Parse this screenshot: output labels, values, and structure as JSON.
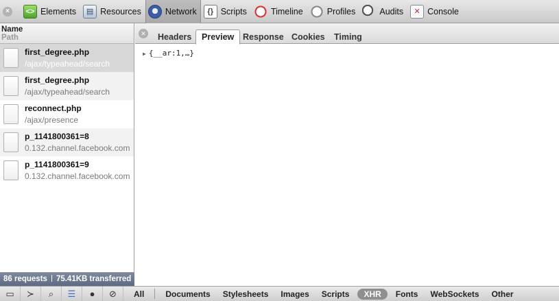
{
  "toolbar": {
    "items": [
      {
        "label": "Elements",
        "icon": "elements-icon",
        "active": false
      },
      {
        "label": "Resources",
        "icon": "resources-icon",
        "active": false
      },
      {
        "label": "Network",
        "icon": "network-icon",
        "active": true
      },
      {
        "label": "Scripts",
        "icon": "scripts-icon",
        "active": false
      },
      {
        "label": "Timeline",
        "icon": "timeline-icon",
        "active": false
      },
      {
        "label": "Profiles",
        "icon": "profiles-icon",
        "active": false
      },
      {
        "label": "Audits",
        "icon": "audits-icon",
        "active": false
      },
      {
        "label": "Console",
        "icon": "console-icon",
        "active": false
      }
    ]
  },
  "requests_panel": {
    "column_name": "Name",
    "column_path": "Path",
    "requests": [
      {
        "name": "first_degree.php",
        "path": "/ajax/typeahead/search",
        "selected": true
      },
      {
        "name": "first_degree.php",
        "path": "/ajax/typeahead/search",
        "selected": false
      },
      {
        "name": "reconnect.php",
        "path": "/ajax/presence",
        "selected": false
      },
      {
        "name": "p_1141800361=8",
        "path": "0.132.channel.facebook.com",
        "selected": false
      },
      {
        "name": "p_1141800361=9",
        "path": "0.132.channel.facebook.com",
        "selected": false
      }
    ],
    "status": {
      "requests": "86 requests",
      "transferred": "75.41KB transferred"
    }
  },
  "detail": {
    "tabs": [
      {
        "label": "Headers",
        "active": false
      },
      {
        "label": "Preview",
        "active": true
      },
      {
        "label": "Response",
        "active": false
      },
      {
        "label": "Cookies",
        "active": false
      },
      {
        "label": "Timing",
        "active": false
      }
    ],
    "preview_text": "{__ar:1,…}"
  },
  "bottom_bar": {
    "filters": [
      {
        "label": "All",
        "active": false
      },
      {
        "label": "Documents",
        "active": false
      },
      {
        "label": "Stylesheets",
        "active": false
      },
      {
        "label": "Images",
        "active": false
      },
      {
        "label": "Scripts",
        "active": false
      },
      {
        "label": "XHR",
        "active": true
      },
      {
        "label": "Fonts",
        "active": false
      },
      {
        "label": "WebSockets",
        "active": false
      },
      {
        "label": "Other",
        "active": false
      }
    ]
  },
  "colors": {
    "selection": "#d8d8d8",
    "status_bar": "#6b778e",
    "active_filter": "#8f8f8f",
    "active_icon": "#3a6bc6"
  }
}
